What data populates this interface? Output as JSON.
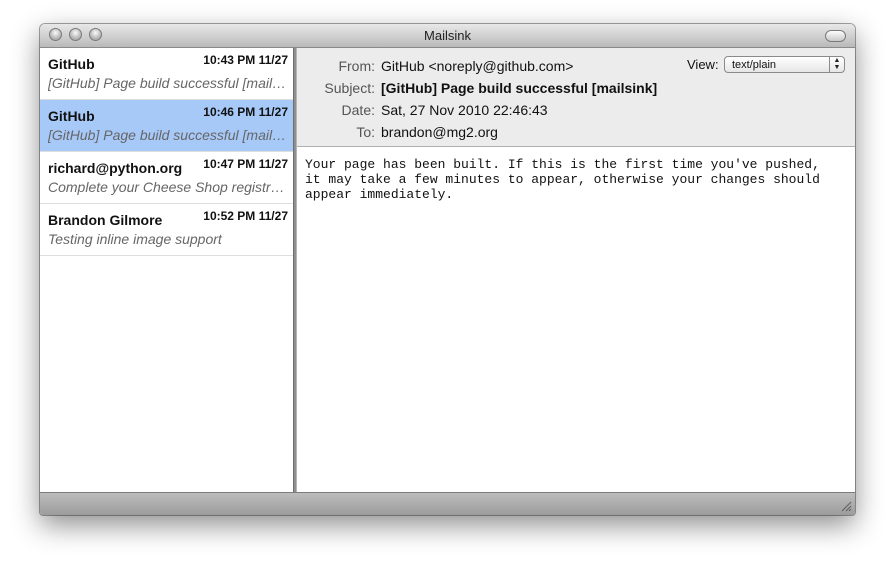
{
  "window": {
    "title": "Mailsink"
  },
  "messages": [
    {
      "sender": "GitHub",
      "time": "10:43 PM 11/27",
      "subject": "[GitHub] Page build successful [mailsink]",
      "selected": false
    },
    {
      "sender": "GitHub",
      "time": "10:46 PM 11/27",
      "subject": "[GitHub] Page build successful [mailsink]",
      "selected": true
    },
    {
      "sender": "richard@python.org",
      "time": "10:47 PM 11/27",
      "subject": "Complete your Cheese Shop registration",
      "selected": false
    },
    {
      "sender": "Brandon Gilmore",
      "time": "10:52 PM 11/27",
      "subject": "Testing inline image support",
      "selected": false
    }
  ],
  "header": {
    "from_label": "From:",
    "from_value": "GitHub <noreply@github.com>",
    "subject_label": "Subject:",
    "subject_value": "[GitHub] Page build successful [mailsink]",
    "date_label": "Date:",
    "date_value": "Sat, 27 Nov 2010 22:46:43",
    "to_label": "To:",
    "to_value": "brandon@mg2.org",
    "view_label": "View:",
    "view_selected": "text/plain"
  },
  "body": "Your page has been built. If this is the first time you've pushed,\nit may take a few minutes to appear, otherwise your changes should\nappear immediately.",
  "colors": {
    "selection": "#a7c9f8"
  }
}
